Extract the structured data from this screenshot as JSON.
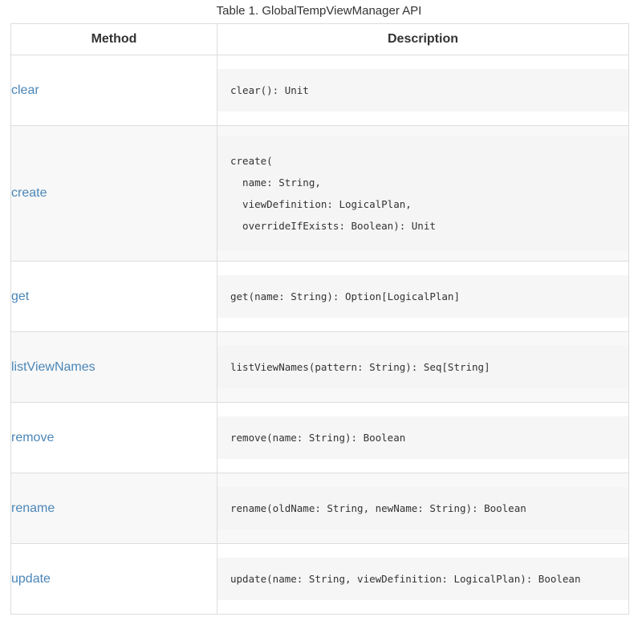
{
  "caption": "Table 1. GlobalTempViewManager API",
  "columns": {
    "method": "Method",
    "description": "Description"
  },
  "colors": {
    "link": "#4a86b8",
    "stripe": "#f8f8f8",
    "code_bg": "#f6f6f6",
    "border": "#dddddd"
  },
  "rows": [
    {
      "method": "clear",
      "signature": "clear(): Unit"
    },
    {
      "method": "create",
      "signature": "create(\n  name: String,\n  viewDefinition: LogicalPlan,\n  overrideIfExists: Boolean): Unit"
    },
    {
      "method": "get",
      "signature": "get(name: String): Option[LogicalPlan]"
    },
    {
      "method": "listViewNames",
      "signature": "listViewNames(pattern: String): Seq[String]"
    },
    {
      "method": "remove",
      "signature": "remove(name: String): Boolean"
    },
    {
      "method": "rename",
      "signature": "rename(oldName: String, newName: String): Boolean"
    },
    {
      "method": "update",
      "signature": "update(name: String, viewDefinition: LogicalPlan): Boolean"
    }
  ]
}
